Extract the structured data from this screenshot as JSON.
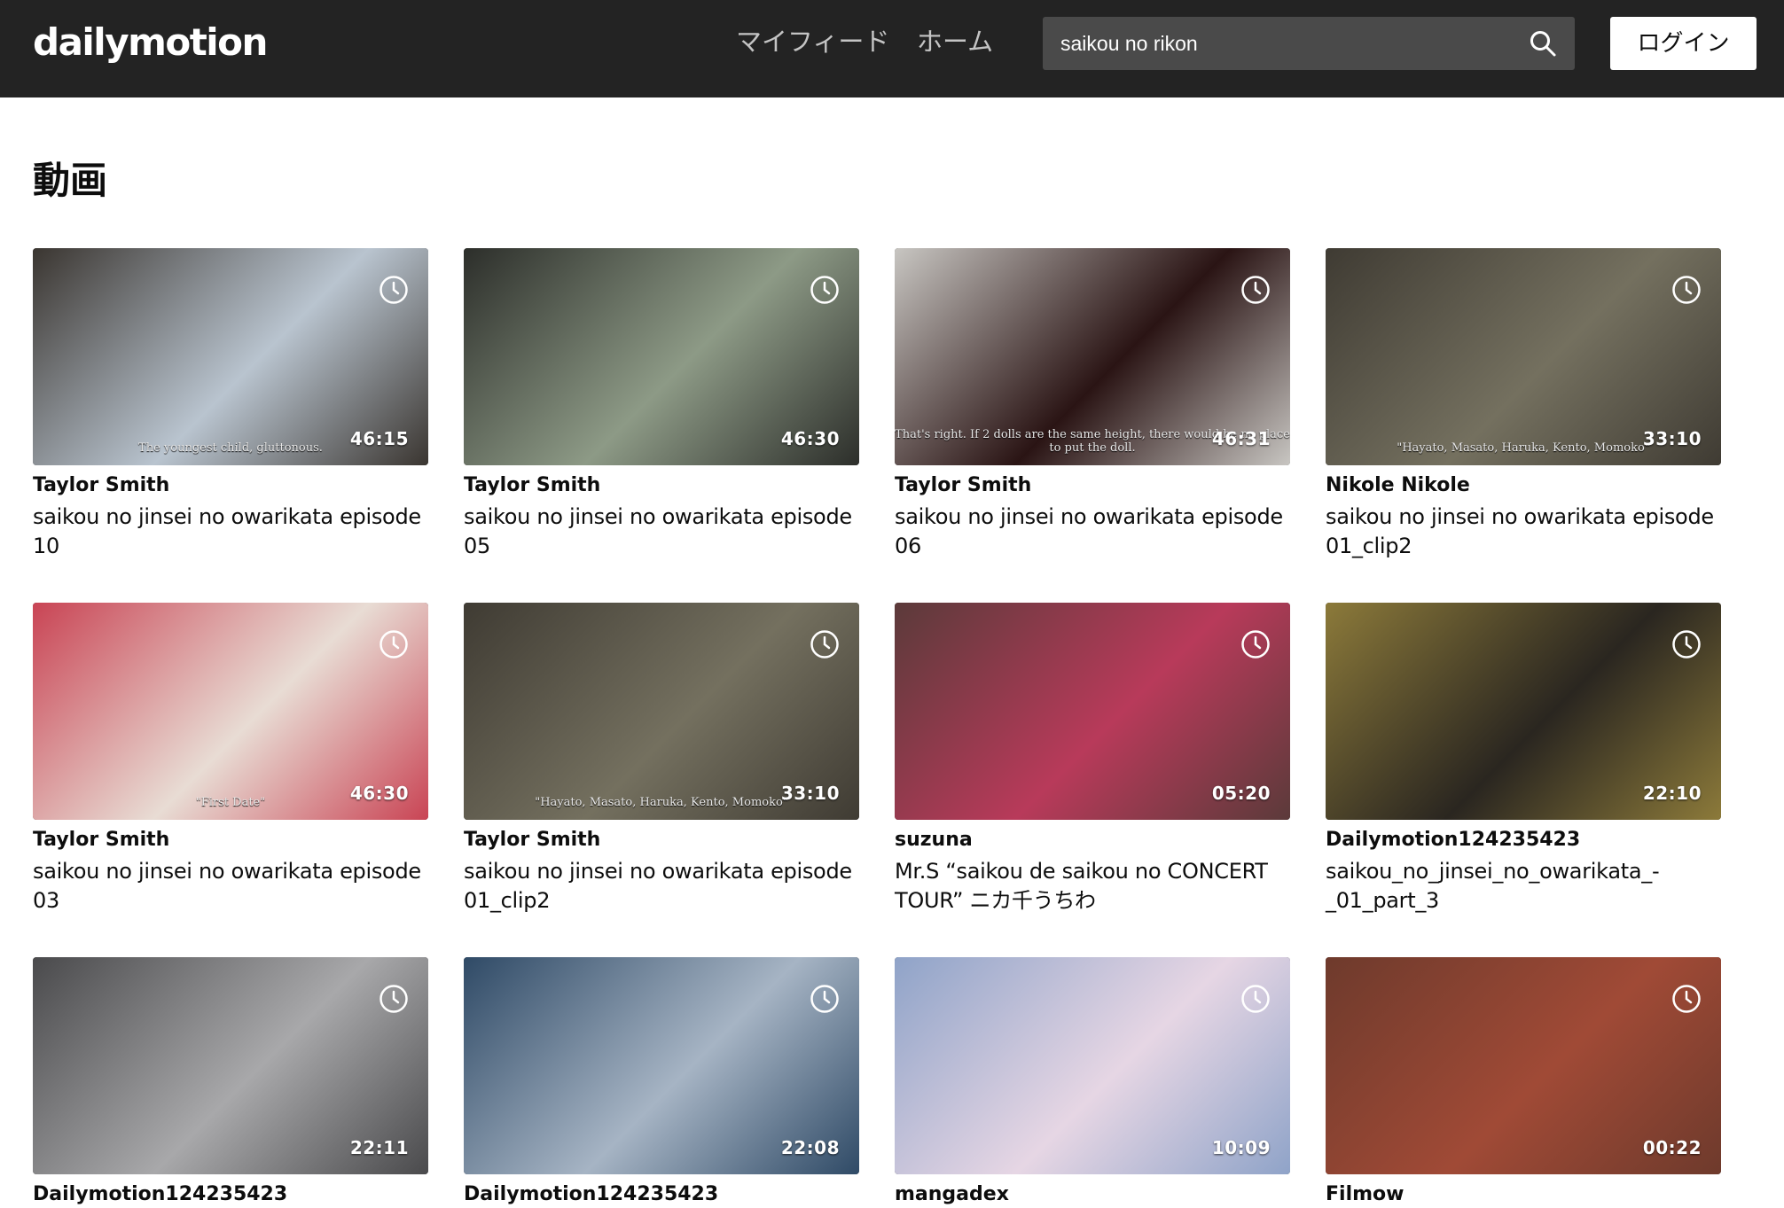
{
  "header": {
    "logo": "dailymotion",
    "nav_feed": "マイフィード",
    "nav_home": "ホーム",
    "search_value": "saikou no rikon",
    "login_label": "ログイン"
  },
  "section_title": "動画",
  "videos": [
    {
      "channel": "Taylor Smith",
      "title": "saikou no jinsei no owarikata episode 10",
      "duration": "46:15",
      "subtitle": "The youngest child, gluttonous."
    },
    {
      "channel": "Taylor Smith",
      "title": "saikou no jinsei no owarikata episode 05",
      "duration": "46:30",
      "subtitle": ""
    },
    {
      "channel": "Taylor Smith",
      "title": "saikou no jinsei no owarikata episode 06",
      "duration": "46:31",
      "subtitle": "That's right. If 2 dolls are the same height, there would be no place to put the doll."
    },
    {
      "channel": "Nikole Nikole",
      "title": "saikou no jinsei no owarikata episode 01_clip2",
      "duration": "33:10",
      "subtitle": "\"Hayato, Masato, Haruka, Kento, Momoko\""
    },
    {
      "channel": "Taylor Smith",
      "title": "saikou no jinsei no owarikata episode 03",
      "duration": "46:30",
      "subtitle": "\"First Date\""
    },
    {
      "channel": "Taylor Smith",
      "title": "saikou no jinsei no owarikata episode 01_clip2",
      "duration": "33:10",
      "subtitle": "\"Hayato, Masato, Haruka, Kento, Momoko\""
    },
    {
      "channel": "suzuna",
      "title": "Mr.S “saikou de saikou no CONCERT TOUR” ニカ千うちわ",
      "duration": "05:20",
      "subtitle": ""
    },
    {
      "channel": "Dailymotion124235423",
      "title": "saikou_no_jinsei_no_owarikata_-_01_part_3",
      "duration": "22:10",
      "subtitle": ""
    },
    {
      "channel": "Dailymotion124235423",
      "title": "",
      "duration": "22:11",
      "subtitle": ""
    },
    {
      "channel": "Dailymotion124235423",
      "title": "",
      "duration": "22:08",
      "subtitle": ""
    },
    {
      "channel": "mangadex",
      "title": "",
      "duration": "10:09",
      "subtitle": ""
    },
    {
      "channel": "Filmow",
      "title": "",
      "duration": "00:22",
      "subtitle": ""
    }
  ],
  "thumb_colors": [
    [
      "#3a3530",
      "#b9c4cf"
    ],
    [
      "#2c2e2a",
      "#8d9a86"
    ],
    [
      "#c8c6c2",
      "#2a1414"
    ],
    [
      "#3f3b33",
      "#74705f"
    ],
    [
      "#c94454",
      "#e8dcd4"
    ],
    [
      "#3f3b33",
      "#74705f"
    ],
    [
      "#5b3a3a",
      "#b83a5a"
    ],
    [
      "#8c7a3a",
      "#2a2620"
    ],
    [
      "#4a4a4c",
      "#a8a8aa"
    ],
    [
      "#2f4a66",
      "#a6b4c4"
    ],
    [
      "#8fa3c8",
      "#e6d6e4"
    ],
    [
      "#6e3a2c",
      "#a04a36"
    ]
  ]
}
